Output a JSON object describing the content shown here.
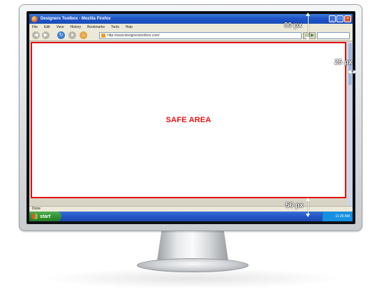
{
  "browser": {
    "window_title": "Designers Toolbox - Mozilla Firefox",
    "menu": [
      "File",
      "Edit",
      "View",
      "History",
      "Bookmarks",
      "Tools",
      "Help"
    ],
    "url": "http://www.designerstoolbox.com/",
    "status": "Done"
  },
  "page": {
    "safe_area_label": "SAFE AREA",
    "safe_area_border_color": "#e01010"
  },
  "taskbar": {
    "start_label": "start",
    "clock": "11:26 AM"
  },
  "dimensions": {
    "top": "90 px",
    "right": "25 px",
    "bottom": "56 px"
  },
  "icons": {
    "back": "back-arrow-icon",
    "forward": "forward-arrow-icon",
    "reload": "reload-icon",
    "stop": "stop-icon",
    "home": "home-icon"
  }
}
